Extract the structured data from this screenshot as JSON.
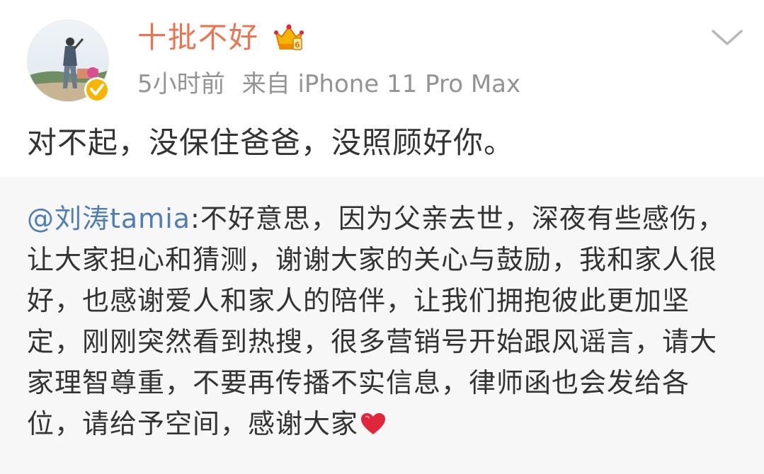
{
  "post": {
    "author": {
      "name": "十批不好"
    },
    "meta": {
      "time": "5小时前",
      "source": "来自 iPhone 11 Pro Max"
    },
    "text": "对不起，没保住爸爸，没照顾好你。"
  },
  "repost": {
    "mention": "@刘涛tamia",
    "text": ":不好意思，因为父亲去世，深夜有些感伤，让大家担心和猜测，谢谢大家的关心与鼓励，我和家人很好，也感谢爱人和家人的陪伴，让我们拥抱彼此更加坚定，刚刚突然看到热搜，很多营销号开始跟风谣言，请大家理智尊重，不要再传播不实信息，律师函也会发给各位，请给予空间，感谢大家"
  },
  "colors": {
    "username": "#eb7350",
    "meta": "#939393",
    "mention": "#4f7db4",
    "repost_bg": "#f7f7f7",
    "verified": "#f7b500",
    "heart": "#e0263a"
  },
  "icons": {
    "verified": "verified-badge-icon",
    "crown": "crown-member-icon",
    "chevron": "chevron-down-icon",
    "heart": "heart-emoji-icon"
  }
}
